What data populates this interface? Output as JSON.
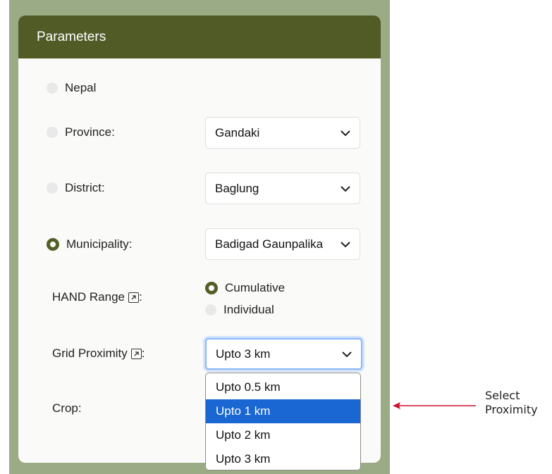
{
  "panel": {
    "title": "Parameters"
  },
  "scope": {
    "nepal": {
      "label": "Nepal",
      "checked": false
    },
    "province": {
      "label": "Province:",
      "checked": false,
      "value": "Gandaki"
    },
    "district": {
      "label": "District:",
      "checked": false,
      "value": "Baglung"
    },
    "municipality": {
      "label": "Municipality:",
      "checked": true,
      "value": "Badigad Gaunpalika"
    }
  },
  "hand_range": {
    "label": "HAND Range",
    "suffix": ":",
    "options": [
      {
        "label": "Cumulative",
        "checked": true
      },
      {
        "label": "Individual",
        "checked": false
      }
    ]
  },
  "grid_proximity": {
    "label": "Grid Proximity",
    "suffix": ":",
    "value": "Upto 3 km",
    "options": [
      "Upto 0.5 km",
      "Upto 1 km",
      "Upto 2 km",
      "Upto 3 km"
    ],
    "highlighted": "Upto 1 km"
  },
  "crop": {
    "label": "Crop:"
  },
  "annotation": {
    "line1": "Select",
    "line2": "Proximity",
    "color": "#c8102e"
  },
  "colors": {
    "header": "#505b26",
    "frame": "#9aab86",
    "highlight": "#1a66d3"
  }
}
